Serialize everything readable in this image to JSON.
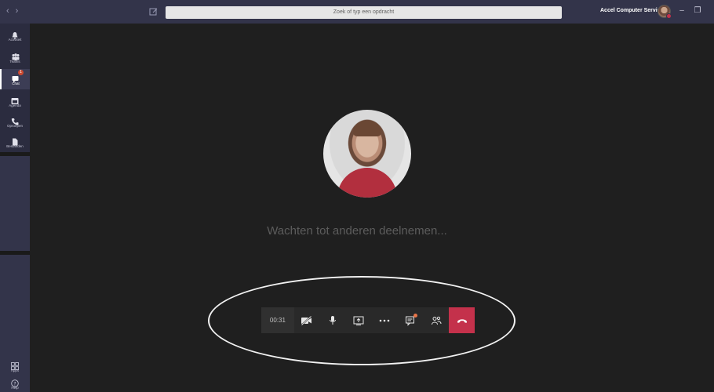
{
  "titlebar": {
    "search_placeholder": "Zoek of typ een opdracht",
    "account_name": "Accel Computer Service",
    "account_chevron": "⌄",
    "back_arrow": "‹",
    "forward_arrow": "›",
    "minimize": "–",
    "maximize": "❐"
  },
  "rail": {
    "items": [
      {
        "label": "Activiteit",
        "icon": "bell-icon"
      },
      {
        "label": "Teams",
        "icon": "teams-icon"
      },
      {
        "label": "Chat",
        "icon": "chat-icon",
        "badge": "1",
        "active": true
      },
      {
        "label": "Agenda",
        "icon": "calendar-icon"
      },
      {
        "label": "Oproepen",
        "icon": "phone-icon"
      },
      {
        "label": "Bestanden",
        "icon": "files-icon"
      }
    ],
    "bottom": [
      {
        "label": "Apps",
        "icon": "apps-icon"
      },
      {
        "label": "Help",
        "icon": "help-icon"
      }
    ]
  },
  "stage": {
    "waiting_text": "Wachten tot anderen deelnemen..."
  },
  "callbar": {
    "timer": "00:31",
    "buttons": [
      "camera-off-icon",
      "microphone-icon",
      "share-screen-icon",
      "more-icon",
      "chat-icon",
      "participants-icon",
      "hangup-icon"
    ]
  },
  "colors": {
    "titlebar": "#33344a",
    "rail": "#2f3043",
    "stage": "#1f1f1f",
    "hangup": "#c4314b",
    "badge": "#cc4a31"
  }
}
